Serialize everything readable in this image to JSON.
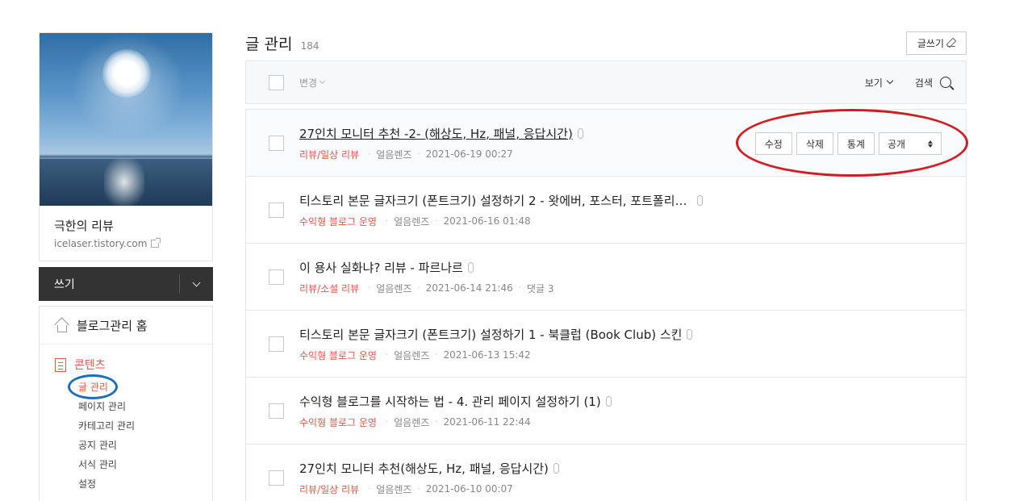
{
  "sidebar": {
    "blog_name": "극한의 리뷰",
    "blog_url": "icelaser.tistory.com",
    "write_label": "쓰기",
    "home_label": "블로그관리 홈",
    "contents_label": "콘텐츠",
    "sub_items": [
      "글 관리",
      "페이지 관리",
      "카테고리 관리",
      "공지 관리",
      "서식 관리",
      "설정"
    ]
  },
  "header": {
    "title": "글 관리",
    "count": "184",
    "new_post_label": "글쓰기"
  },
  "toolbar": {
    "change_label": "변경",
    "view_label": "보기",
    "search_label": "검색"
  },
  "row_actions": {
    "edit": "수정",
    "delete": "삭제",
    "stats": "통계",
    "visibility": "공개"
  },
  "posts": [
    {
      "title": "27인치 모니터 추천 -2- (해상도, Hz, 패널, 응답시간)",
      "category": "리뷰/일상 리뷰",
      "author": "얼음렌즈",
      "date": "2021-06-19 00:27",
      "comments": ""
    },
    {
      "title": "티스토리 본문 글자크기 (폰트크기) 설정하기 2 - 왓에버, 포스터, 포트폴리…",
      "category": "수익형 블로그 운영",
      "author": "얼음렌즈",
      "date": "2021-06-16 01:48",
      "comments": ""
    },
    {
      "title": "이 용사 실화냐? 리뷰 - 파르나르",
      "category": "리뷰/소설 리뷰",
      "author": "얼음렌즈",
      "date": "2021-06-14 21:46",
      "comments": "댓글 3"
    },
    {
      "title": "티스토리 본문 글자크기 (폰트크기) 설정하기 1 - 북클럽 (Book Club) 스킨",
      "category": "수익형 블로그 운영",
      "author": "얼음렌즈",
      "date": "2021-06-13 15:42",
      "comments": ""
    },
    {
      "title": "수익형 블로그를 시작하는 법 - 4. 관리 페이지 설정하기 (1)",
      "category": "수익형 블로그 운영",
      "author": "얼음렌즈",
      "date": "2021-06-11 22:44",
      "comments": ""
    },
    {
      "title": "27인치 모니터 추천(해상도, Hz, 패널, 응답시간)",
      "category": "리뷰/일상 리뷰",
      "author": "얼음렌즈",
      "date": "2021-06-10 00:07",
      "comments": ""
    }
  ],
  "colors": {
    "accent": "#e3584a",
    "annotation_red": "#d51a22",
    "annotation_blue": "#1f6fb8",
    "write_bar": "#333333"
  }
}
